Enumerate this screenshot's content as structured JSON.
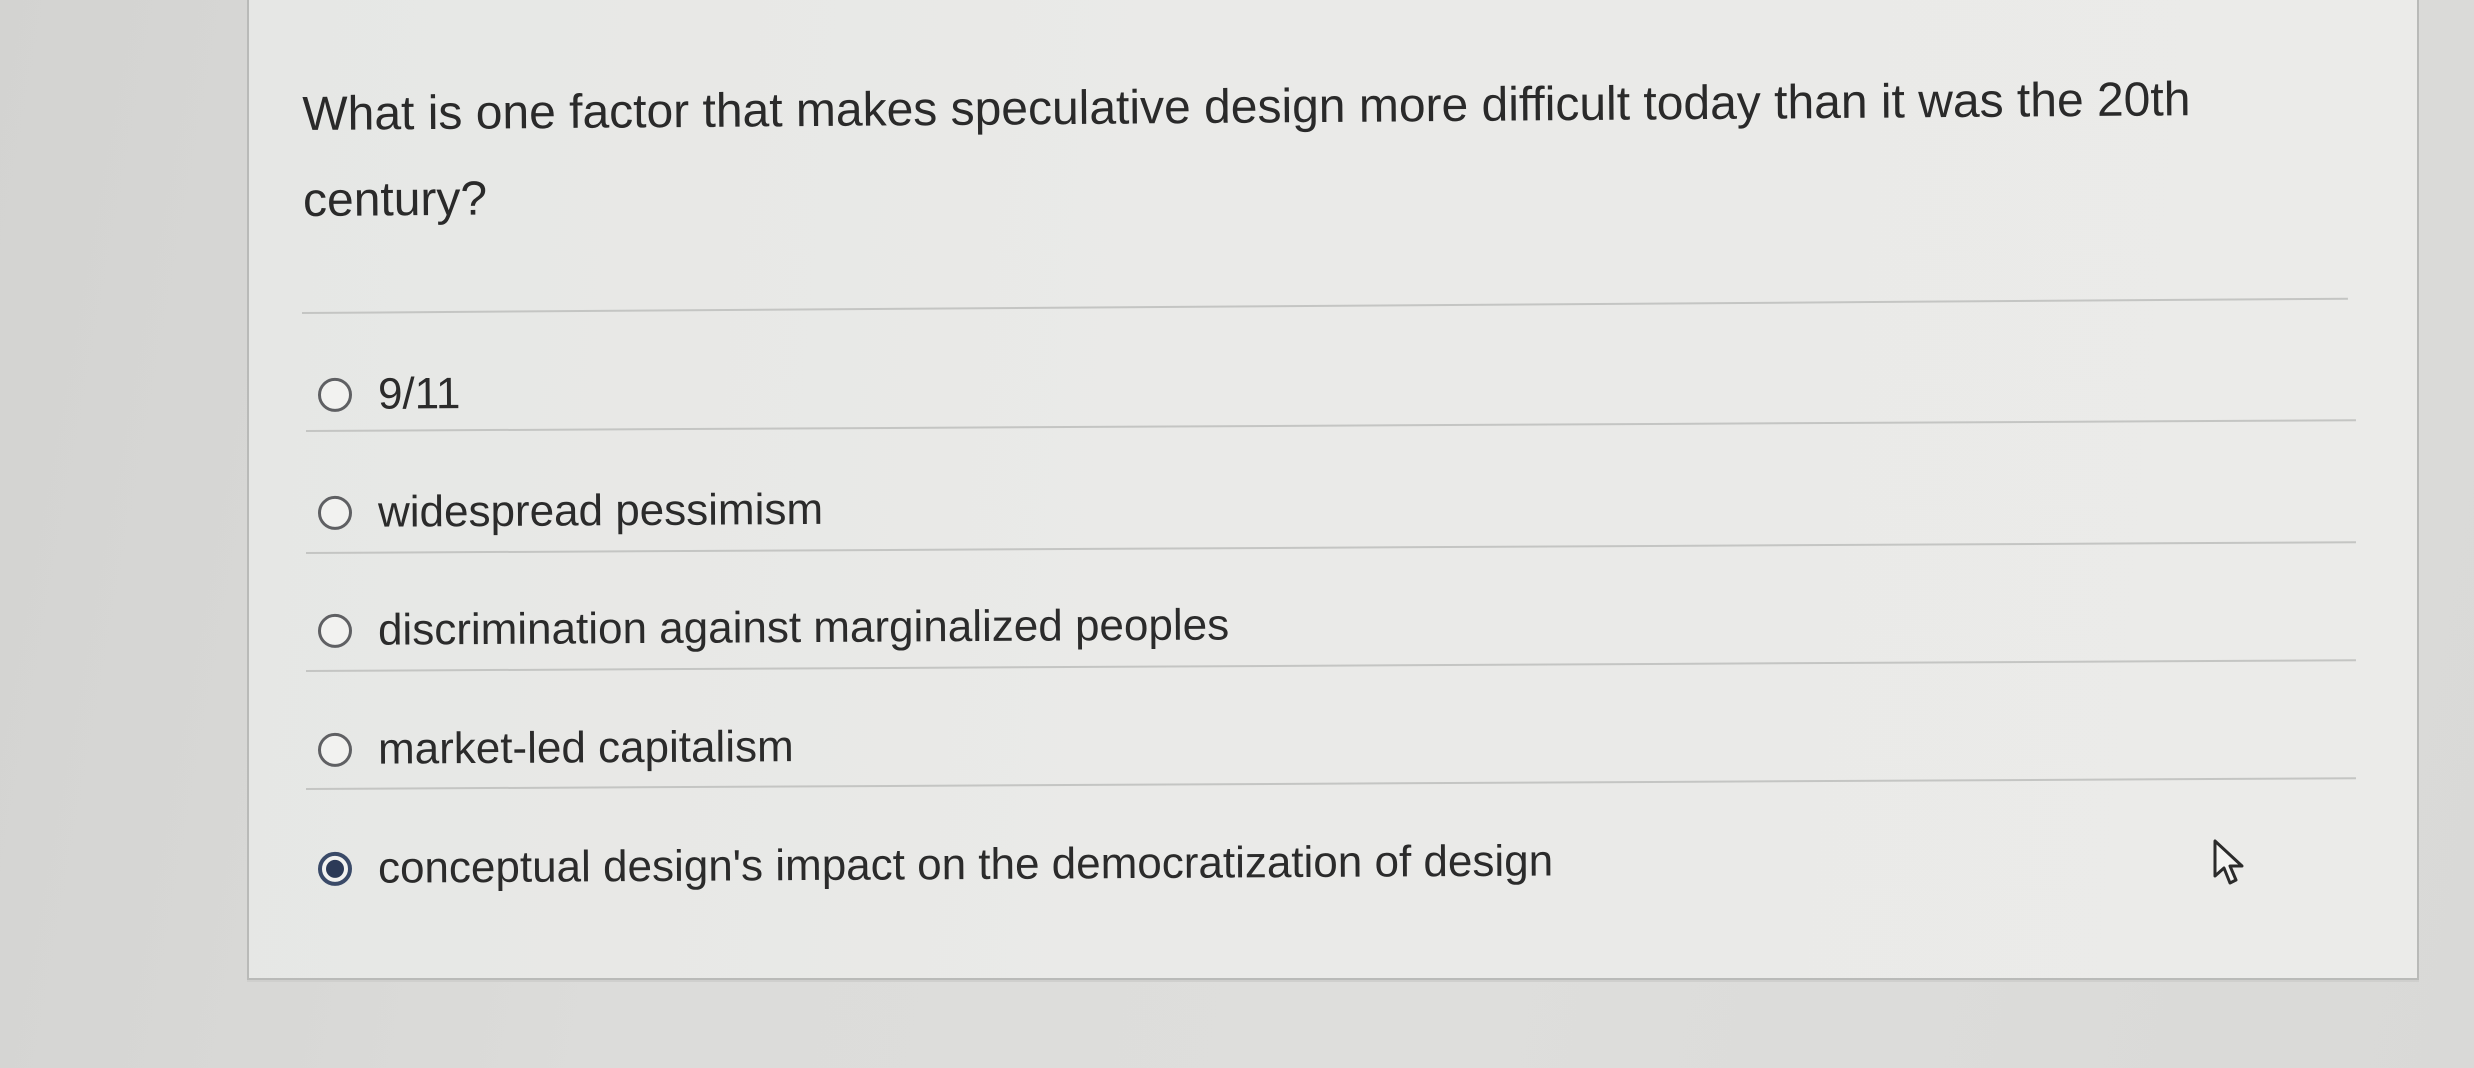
{
  "question": {
    "text": "What is one factor that makes speculative design more difficult today than it was the 20th century?"
  },
  "options": [
    {
      "label": "9/11",
      "selected": false
    },
    {
      "label": "widespread pessimism",
      "selected": false
    },
    {
      "label": "discrimination against marginalized peoples",
      "selected": false
    },
    {
      "label": "market-led capitalism",
      "selected": false
    },
    {
      "label": "conceptual design's impact on the democratization of design",
      "selected": true
    }
  ],
  "cursor": {
    "icon": "mouse-pointer-icon"
  },
  "colors": {
    "selected_radio": "#2c3a57",
    "text": "#2b2b2b",
    "card_background": "#e9e9e7",
    "page_background": "#d9d9d7"
  }
}
